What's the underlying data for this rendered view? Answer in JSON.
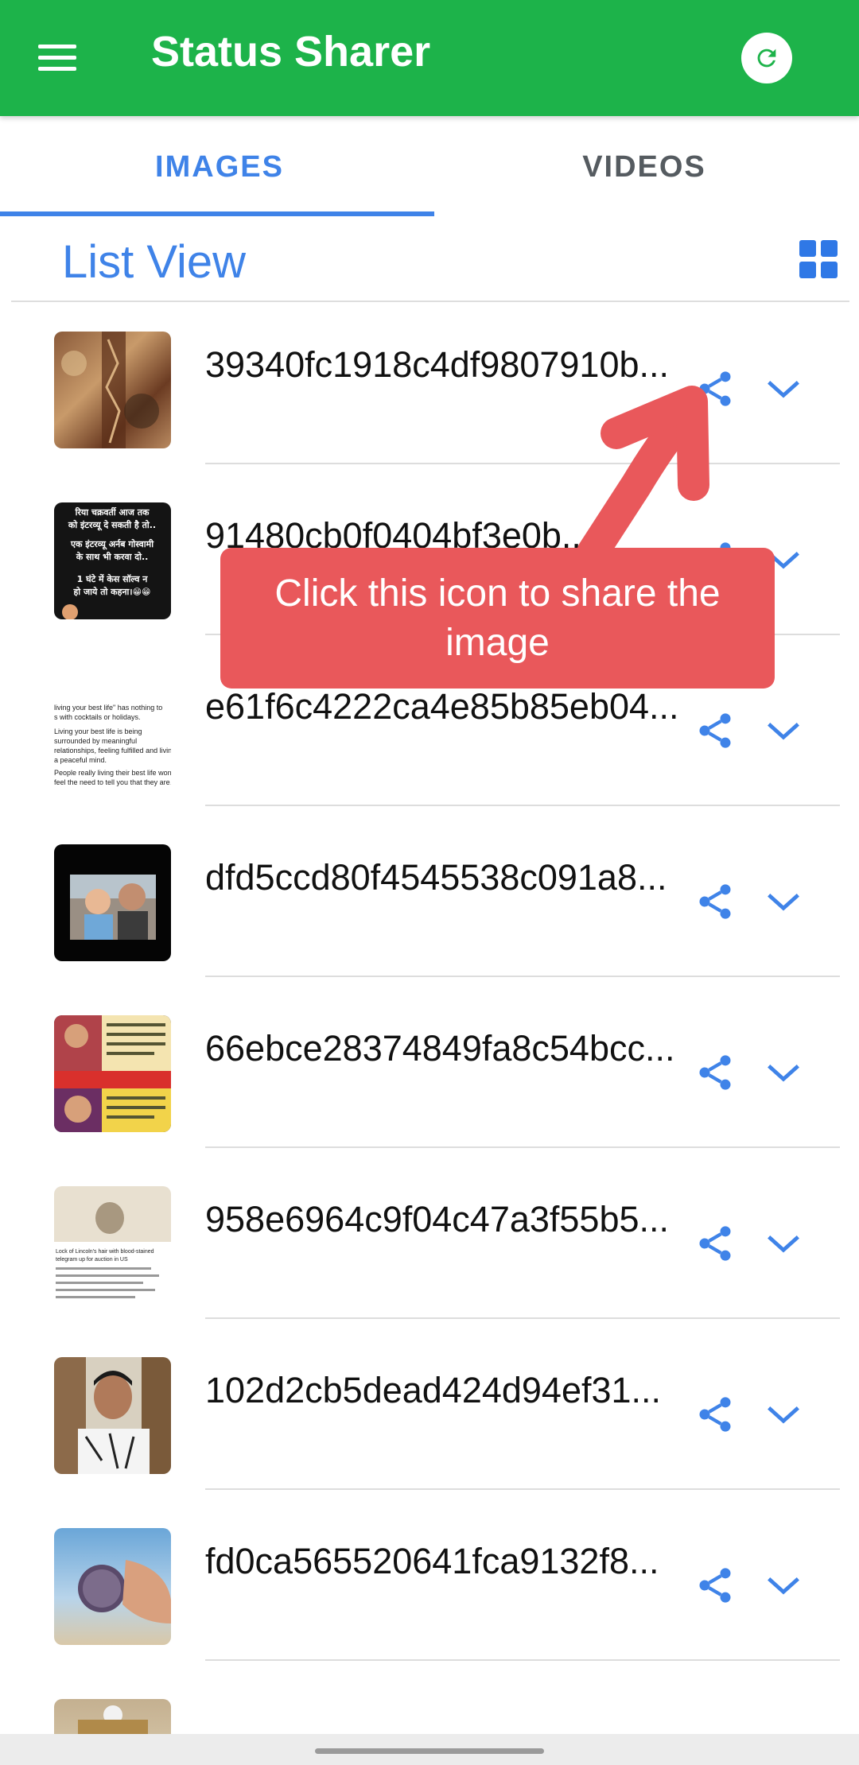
{
  "app": {
    "title": "Status Sharer"
  },
  "tabs": [
    {
      "label": "IMAGES",
      "selected": true
    },
    {
      "label": "VIDEOS",
      "selected": false
    }
  ],
  "list_header": {
    "title": "List View"
  },
  "files": [
    {
      "name": "39340fc1918c4df9807910b..."
    },
    {
      "name": "91480cb0f0404bf3e0b...ff"
    },
    {
      "name": "e61f6c4222ca4e85b85eb04..."
    },
    {
      "name": "dfd5ccd80f4545538c091a8..."
    },
    {
      "name": "66ebce28374849fa8c54bcc..."
    },
    {
      "name": "958e6964c9f04c47a3f55b5..."
    },
    {
      "name": "102d2cb5dead424d94ef31..."
    },
    {
      "name": "fd0ca565520641fca9132f8..."
    }
  ],
  "thumbnails": {
    "thumb2_lines": [
      "रिया चक्रवर्ती आज तक",
      "को इंटरव्यू दे सकती है तो..",
      "एक इंटरव्यू अर्नब गोस्वामी",
      "के साथ भी करवा दो..",
      "1 घंटे में केस सॉल्व न",
      "हो जाये तो कहना।😁😁"
    ],
    "thumb3_lines": [
      "living your best life\" has nothing to",
      "s with cocktails or holidays.",
      "Living your best life is being",
      "surrounded by meaningful",
      "relationships, feeling fulfilled and livin",
      "a peaceful mind.",
      "People really living their best life won'",
      "feel the need to tell you that they are."
    ],
    "thumb6_lines": [
      "Lock of Lincoln's hair with blood-stained",
      "telegram up for auction in US"
    ]
  },
  "tooltip": {
    "text": "Click this icon to share the image"
  },
  "colors": {
    "app_bar": "#1db34a",
    "accent": "#3f83e8",
    "tooltip": "#e9585b"
  }
}
